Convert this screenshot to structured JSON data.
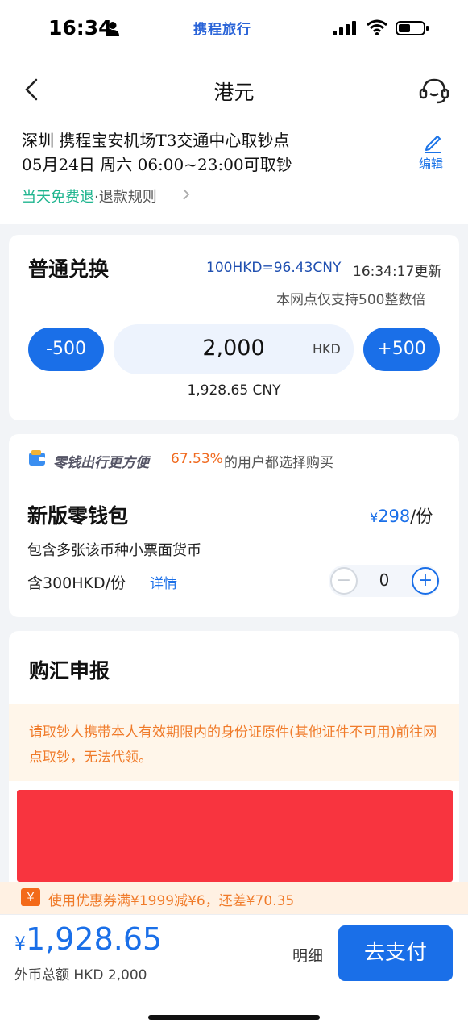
{
  "status_bar": {
    "time": "16:34",
    "brand": "携程旅行"
  },
  "header": {
    "title": "港元",
    "location": "深圳  携程宝安机场T3交通中心取钞点",
    "pickup_time": "05月24日  周六  06:00~23:00可取钞",
    "edit_label": "编辑",
    "refund_free": "当天免费退",
    "refund_rule": "·退款规则"
  },
  "exchange": {
    "title": "普通兑换",
    "rate": "100HKD=96.43CNY",
    "rate_time": "16:34:17更新",
    "multiple_note": "本网点仅支持500整数倍",
    "minus_label": "-500",
    "plus_label": "+500",
    "amount": "2,000",
    "amount_unit": "HKD",
    "cny_amount": "1,928.65 CNY"
  },
  "wallet_promo": {
    "slogan": "零钱出行更方便",
    "percent": "67.53%",
    "rest": "的用户都选择购买",
    "title": "新版零钱包",
    "price_symbol": "¥",
    "price": "298",
    "price_unit": "/份",
    "desc": "包含多张该币种小票面货币",
    "contains": "含300HKD/份",
    "detail_link": "详情",
    "quantity": "0",
    "minus_symbol": "−",
    "plus_symbol": "+"
  },
  "declaration": {
    "title": "购汇申报",
    "notice": "请取钞人携带本人有效期限内的身份证原件(其他证件不可用)前往网点取钞，无法代领。"
  },
  "coupon": {
    "icon_text": "¥",
    "text": "使用优惠券满¥1999减¥6，还差¥70.35"
  },
  "footer": {
    "price_symbol": "¥",
    "total": "1,928.65",
    "foreign_total": "外币总额  HKD 2,000",
    "detail_label": "明细",
    "pay_label": "去支付"
  },
  "colors": {
    "accent": "#1a6fe8",
    "green": "#1fb58f",
    "orange": "#f07b2a",
    "red_block": "#f8343f"
  }
}
